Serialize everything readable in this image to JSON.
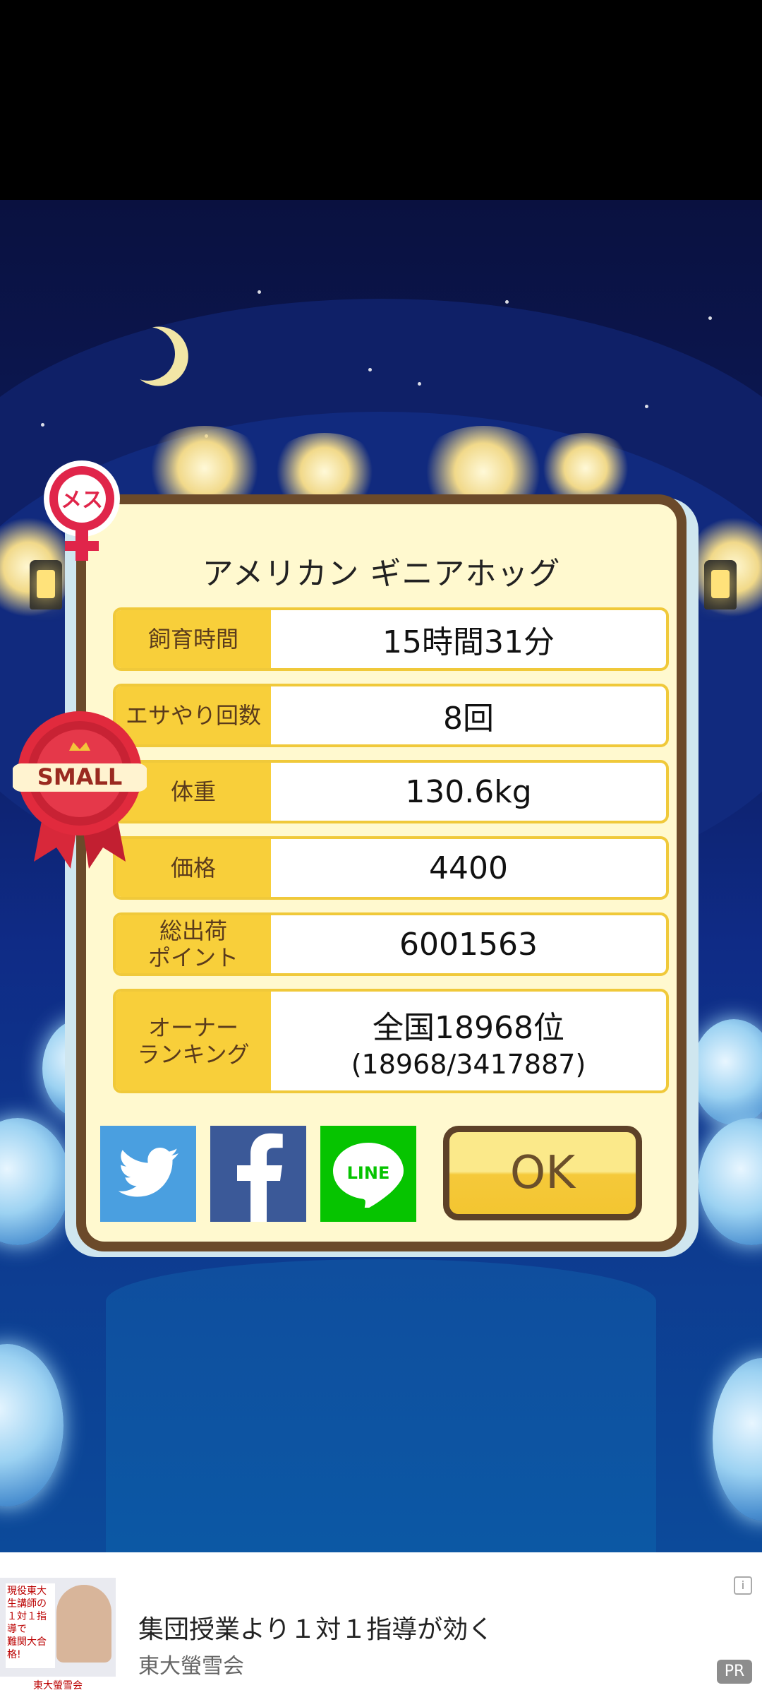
{
  "dialog": {
    "animal_name": "アメリカン ギニアホッグ",
    "gender_badge": "メス",
    "size_badge": "SMALL",
    "rows": [
      {
        "label": "飼育時間",
        "value": "15時間31分"
      },
      {
        "label": "エサやり回数",
        "value": "8回"
      },
      {
        "label": "体重",
        "value": "130.6kg"
      },
      {
        "label": "価格",
        "value": "4400"
      },
      {
        "label": "総出荷\nポイント",
        "value": "6001563"
      },
      {
        "label": "オーナー\nランキング",
        "value": "全国18968位",
        "sub": "(18968/3417887)"
      }
    ],
    "share": {
      "twitter_icon": "twitter-bird-icon",
      "facebook_icon": "facebook-f-icon",
      "line_label": "LINE"
    },
    "ok_label": "OK"
  },
  "ad": {
    "title": "集団授業より１対１指導が効く",
    "advertiser": "東大螢雪会",
    "thumb_lines": [
      "現役東大生講師の",
      "１対１指導で",
      "難関大合格!"
    ],
    "thumb_brand": "東大螢雪会",
    "info": "i",
    "pr": "PR"
  },
  "colors": {
    "panel_bg": "#fff9cf",
    "panel_border": "#6b4a2a",
    "label_bg": "#f8cf3a",
    "ok_bg": "#f5c93a"
  }
}
